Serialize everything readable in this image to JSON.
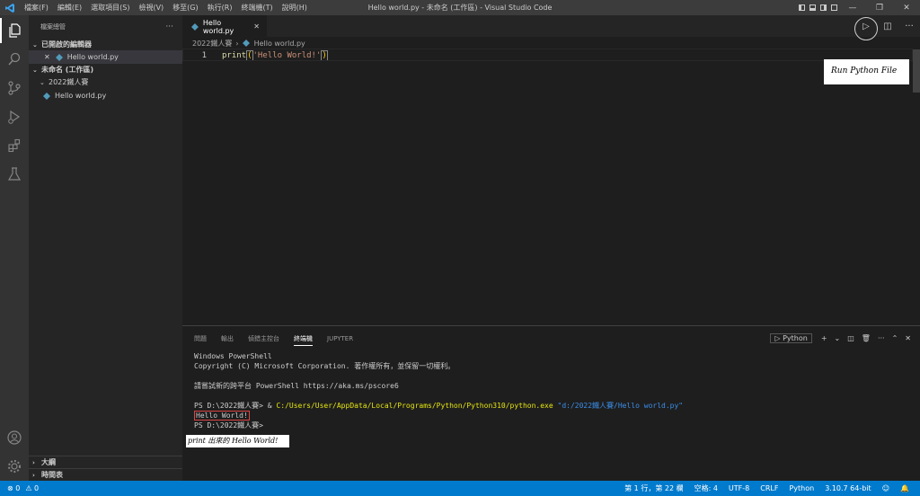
{
  "window": {
    "title": "Hello world.py - 未命名 (工作區) - Visual Studio Code",
    "logo": "vscode-logo",
    "menu": [
      "檔案(F)",
      "編輯(E)",
      "選取項目(S)",
      "檢視(V)",
      "移至(G)",
      "執行(R)",
      "終端機(T)",
      "說明(H)"
    ],
    "controls": {
      "minimize": "—",
      "restore": "❐",
      "close": "✕"
    }
  },
  "activity": [
    "files-icon",
    "search-icon",
    "source-control-icon",
    "run-debug-icon",
    "extensions-icon",
    "testing-icon",
    "account-icon",
    "gear-icon"
  ],
  "sidebar": {
    "title": "檔案總管",
    "more": "···",
    "open_editors": {
      "label": "已開啟的編輯器",
      "files": [
        {
          "close": "✕",
          "name": "Hello world.py"
        }
      ]
    },
    "workspace": {
      "label": "未命名 (工作區)",
      "folder": "2022鐵人賽",
      "files": [
        "Hello world.py"
      ]
    },
    "outline": "大綱",
    "timeline": "時間表"
  },
  "editor": {
    "tab": {
      "label": "Hello world.py",
      "close": "✕"
    },
    "breadcrumb": {
      "folder": "2022鐵人賽",
      "sep": "›",
      "file": "Hello world.py"
    },
    "lines": [
      {
        "number": "1",
        "fn": "print",
        "open": "(",
        "string": "'Hello World!'",
        "close": ")"
      }
    ],
    "actions": {
      "run": "▷",
      "split": "◫",
      "more": "···"
    },
    "annotation": "Run Python File"
  },
  "panel": {
    "tabs": [
      "問題",
      "輸出",
      "偵錯主控台",
      "終端機",
      "JUPYTER"
    ],
    "active_tab": "終端機",
    "shell": "Python",
    "actions": {
      "add": "+",
      "dropdown": "⌄",
      "split": "◫",
      "trash": "🗑",
      "more": "···",
      "maximize": "⌃",
      "close": "✕"
    },
    "terminal": {
      "l1": "Windows PowerShell",
      "l2": "Copyright (C) Microsoft Corporation. 著作權所有，並保留一切權利。",
      "l3": "",
      "l4": "請嘗試新的跨平台 PowerShell https://aka.ms/pscore6",
      "l5": "",
      "l6_prompt": "PS D:\\2022鐵人賽> ",
      "l6_amp": "& ",
      "l6_exe": "C:/Users/User/AppData/Local/Programs/Python/Python310/python.exe",
      "l6_arg": "\"d:/2022鐵人賽/Hello world.py\"",
      "l7": "Hello World!",
      "l8": "PS D:\\2022鐵人賽>"
    },
    "annotation": "print 出來的 Hello World!"
  },
  "status": {
    "errors": "⊗ 0",
    "warnings": "⚠ 0",
    "position": "第 1 行，第 22 欄",
    "spaces": "空格: 4",
    "encoding": "UTF-8",
    "eol": "CRLF",
    "language": "Python",
    "interpreter": "3.10.7 64-bit"
  },
  "colors": {
    "accent": "#007acc",
    "python_icon": "#519aba"
  }
}
